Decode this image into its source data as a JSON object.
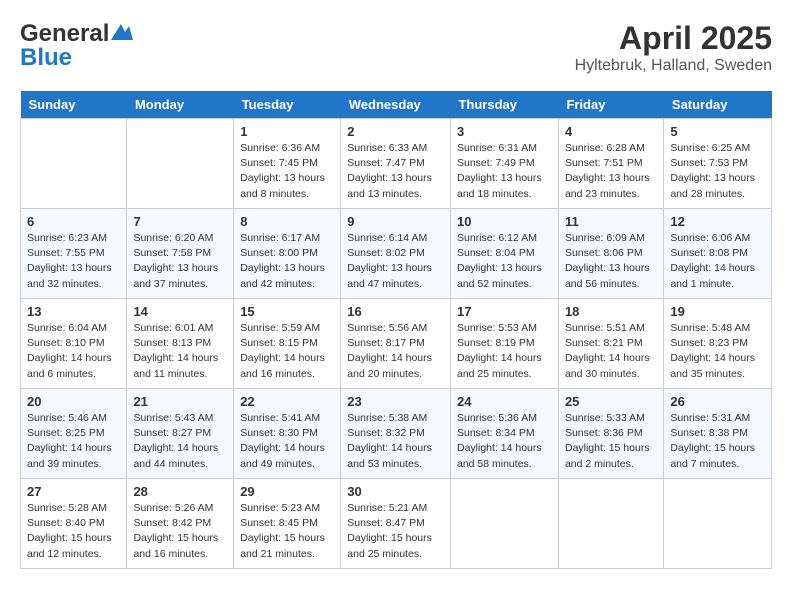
{
  "header": {
    "logo_line1": "General",
    "logo_line2": "Blue",
    "month": "April 2025",
    "location": "Hyltebruk, Halland, Sweden"
  },
  "weekdays": [
    "Sunday",
    "Monday",
    "Tuesday",
    "Wednesday",
    "Thursday",
    "Friday",
    "Saturday"
  ],
  "weeks": [
    [
      {
        "day": "",
        "info": ""
      },
      {
        "day": "",
        "info": ""
      },
      {
        "day": "1",
        "info": "Sunrise: 6:36 AM\nSunset: 7:45 PM\nDaylight: 13 hours and 8 minutes."
      },
      {
        "day": "2",
        "info": "Sunrise: 6:33 AM\nSunset: 7:47 PM\nDaylight: 13 hours and 13 minutes."
      },
      {
        "day": "3",
        "info": "Sunrise: 6:31 AM\nSunset: 7:49 PM\nDaylight: 13 hours and 18 minutes."
      },
      {
        "day": "4",
        "info": "Sunrise: 6:28 AM\nSunset: 7:51 PM\nDaylight: 13 hours and 23 minutes."
      },
      {
        "day": "5",
        "info": "Sunrise: 6:25 AM\nSunset: 7:53 PM\nDaylight: 13 hours and 28 minutes."
      }
    ],
    [
      {
        "day": "6",
        "info": "Sunrise: 6:23 AM\nSunset: 7:55 PM\nDaylight: 13 hours and 32 minutes."
      },
      {
        "day": "7",
        "info": "Sunrise: 6:20 AM\nSunset: 7:58 PM\nDaylight: 13 hours and 37 minutes."
      },
      {
        "day": "8",
        "info": "Sunrise: 6:17 AM\nSunset: 8:00 PM\nDaylight: 13 hours and 42 minutes."
      },
      {
        "day": "9",
        "info": "Sunrise: 6:14 AM\nSunset: 8:02 PM\nDaylight: 13 hours and 47 minutes."
      },
      {
        "day": "10",
        "info": "Sunrise: 6:12 AM\nSunset: 8:04 PM\nDaylight: 13 hours and 52 minutes."
      },
      {
        "day": "11",
        "info": "Sunrise: 6:09 AM\nSunset: 8:06 PM\nDaylight: 13 hours and 56 minutes."
      },
      {
        "day": "12",
        "info": "Sunrise: 6:06 AM\nSunset: 8:08 PM\nDaylight: 14 hours and 1 minute."
      }
    ],
    [
      {
        "day": "13",
        "info": "Sunrise: 6:04 AM\nSunset: 8:10 PM\nDaylight: 14 hours and 6 minutes."
      },
      {
        "day": "14",
        "info": "Sunrise: 6:01 AM\nSunset: 8:13 PM\nDaylight: 14 hours and 11 minutes."
      },
      {
        "day": "15",
        "info": "Sunrise: 5:59 AM\nSunset: 8:15 PM\nDaylight: 14 hours and 16 minutes."
      },
      {
        "day": "16",
        "info": "Sunrise: 5:56 AM\nSunset: 8:17 PM\nDaylight: 14 hours and 20 minutes."
      },
      {
        "day": "17",
        "info": "Sunrise: 5:53 AM\nSunset: 8:19 PM\nDaylight: 14 hours and 25 minutes."
      },
      {
        "day": "18",
        "info": "Sunrise: 5:51 AM\nSunset: 8:21 PM\nDaylight: 14 hours and 30 minutes."
      },
      {
        "day": "19",
        "info": "Sunrise: 5:48 AM\nSunset: 8:23 PM\nDaylight: 14 hours and 35 minutes."
      }
    ],
    [
      {
        "day": "20",
        "info": "Sunrise: 5:46 AM\nSunset: 8:25 PM\nDaylight: 14 hours and 39 minutes."
      },
      {
        "day": "21",
        "info": "Sunrise: 5:43 AM\nSunset: 8:27 PM\nDaylight: 14 hours and 44 minutes."
      },
      {
        "day": "22",
        "info": "Sunrise: 5:41 AM\nSunset: 8:30 PM\nDaylight: 14 hours and 49 minutes."
      },
      {
        "day": "23",
        "info": "Sunrise: 5:38 AM\nSunset: 8:32 PM\nDaylight: 14 hours and 53 minutes."
      },
      {
        "day": "24",
        "info": "Sunrise: 5:36 AM\nSunset: 8:34 PM\nDaylight: 14 hours and 58 minutes."
      },
      {
        "day": "25",
        "info": "Sunrise: 5:33 AM\nSunset: 8:36 PM\nDaylight: 15 hours and 2 minutes."
      },
      {
        "day": "26",
        "info": "Sunrise: 5:31 AM\nSunset: 8:38 PM\nDaylight: 15 hours and 7 minutes."
      }
    ],
    [
      {
        "day": "27",
        "info": "Sunrise: 5:28 AM\nSunset: 8:40 PM\nDaylight: 15 hours and 12 minutes."
      },
      {
        "day": "28",
        "info": "Sunrise: 5:26 AM\nSunset: 8:42 PM\nDaylight: 15 hours and 16 minutes."
      },
      {
        "day": "29",
        "info": "Sunrise: 5:23 AM\nSunset: 8:45 PM\nDaylight: 15 hours and 21 minutes."
      },
      {
        "day": "30",
        "info": "Sunrise: 5:21 AM\nSunset: 8:47 PM\nDaylight: 15 hours and 25 minutes."
      },
      {
        "day": "",
        "info": ""
      },
      {
        "day": "",
        "info": ""
      },
      {
        "day": "",
        "info": ""
      }
    ]
  ]
}
